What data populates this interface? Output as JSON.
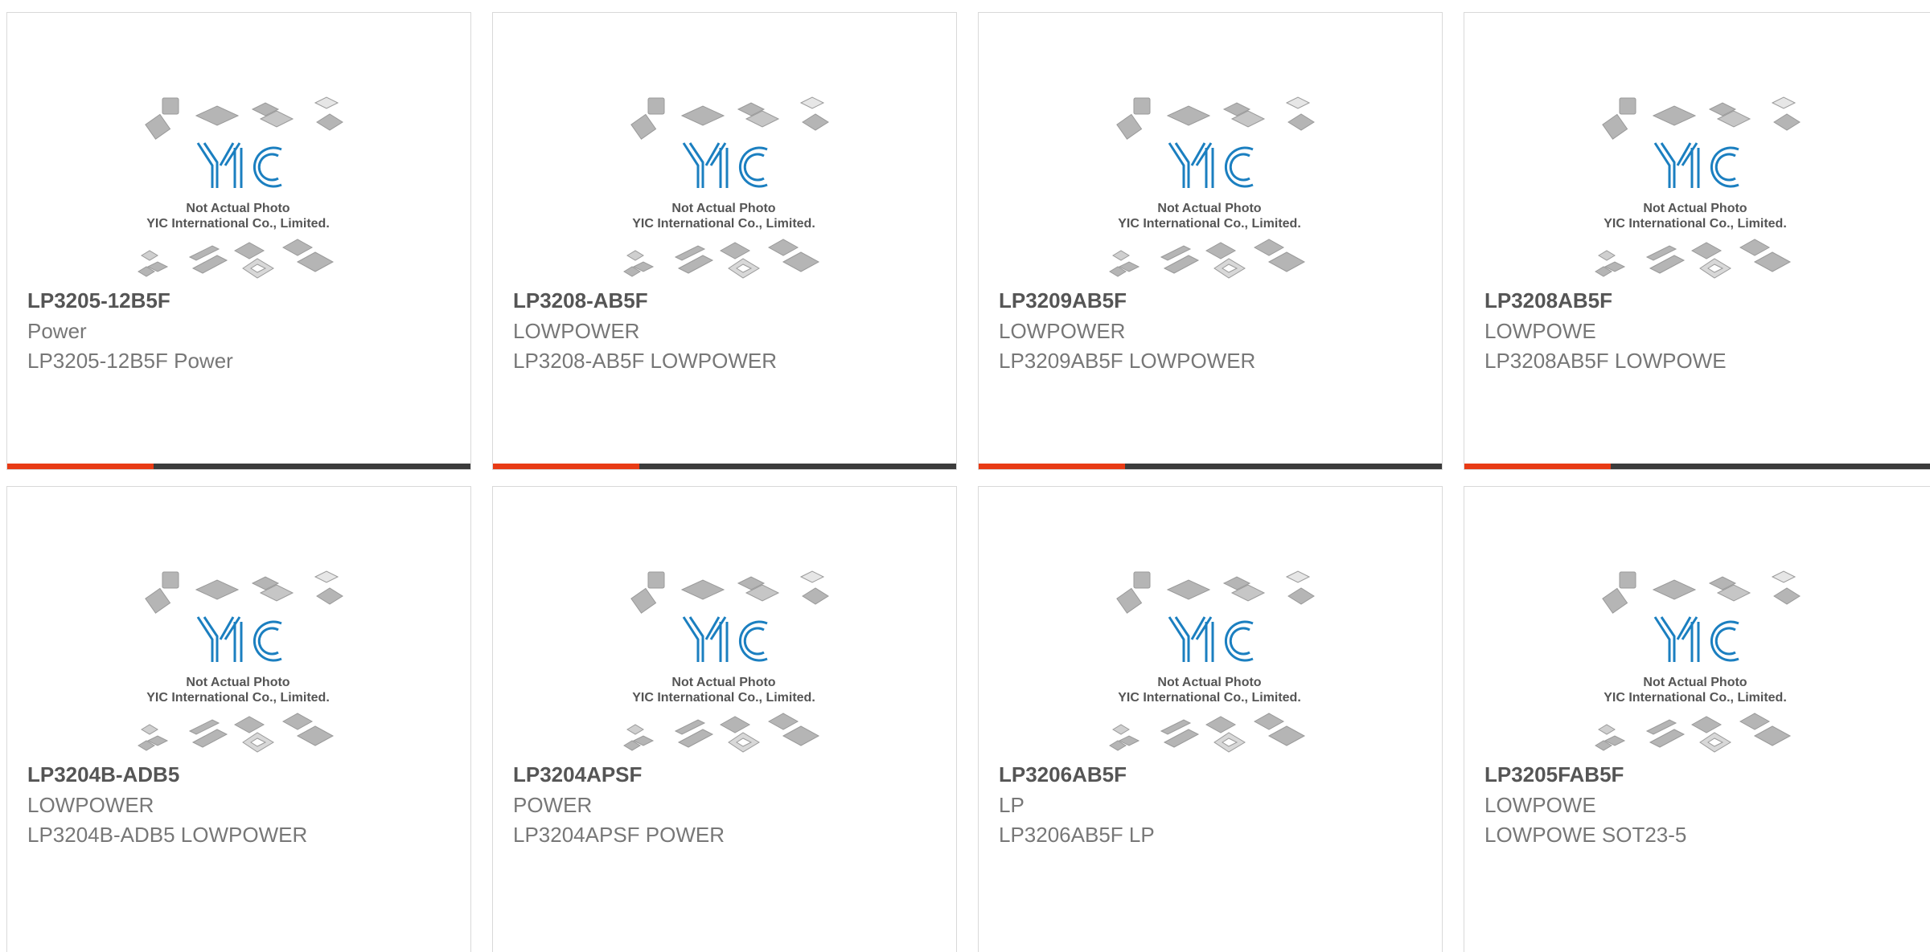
{
  "placeholder": {
    "logo_text": "YIC",
    "line1": "Not Actual Photo",
    "line2": "YIC International Co., Limited."
  },
  "colors": {
    "accent": "#e83b15",
    "bar": "#3c3c3c",
    "logo_blue": "#1b7fc0"
  },
  "products": [
    {
      "part": "LP3205-12B5F",
      "category": "Power",
      "description": "LP3205-12B5F Power"
    },
    {
      "part": "LP3208-AB5F",
      "category": "LOWPOWER",
      "description": "LP3208-AB5F LOWPOWER"
    },
    {
      "part": "LP3209AB5F",
      "category": "LOWPOWER",
      "description": "LP3209AB5F LOWPOWER"
    },
    {
      "part": "LP3208AB5F",
      "category": "LOWPOWE",
      "description": "LP3208AB5F LOWPOWE"
    },
    {
      "part": "LP3204B-ADB5",
      "category": "LOWPOWER",
      "description": "LP3204B-ADB5 LOWPOWER"
    },
    {
      "part": "LP3204APSF",
      "category": "POWER",
      "description": "LP3204APSF POWER"
    },
    {
      "part": "LP3206AB5F",
      "category": "LP",
      "description": "LP3206AB5F LP"
    },
    {
      "part": "LP3205FAB5F",
      "category": "LOWPOWE",
      "description": "LOWPOWE SOT23-5"
    }
  ]
}
